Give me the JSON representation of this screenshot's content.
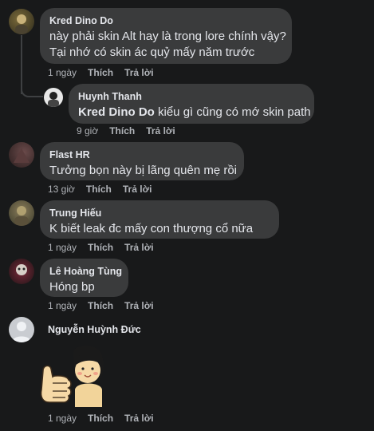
{
  "comments": [
    {
      "author": "Kred Dino Do",
      "lines": [
        "này phải skin Alt hay là trong lore chính vậy?",
        "Tại nhớ có skin ác quỷ mấy năm trước"
      ],
      "time": "1 ngày",
      "like": "Thích",
      "reply": "Trả lời"
    },
    {
      "author": "Huynh Thanh",
      "tag": "Kred Dino Do",
      "text": " kiểu gì cũng có mớ skin path",
      "time": "9 giờ",
      "like": "Thích",
      "reply": "Trả lời"
    },
    {
      "author": "Flast HR",
      "text": "Tưởng bọn này bị lãng quên mẹ rồi",
      "time": "13 giờ",
      "like": "Thích",
      "reply": "Trả lời"
    },
    {
      "author": "Trung Hiếu",
      "text": "K biết leak đc mấy con thượng cổ nữa",
      "time": "1 ngày",
      "like": "Thích",
      "reply": "Trả lời"
    },
    {
      "author": "Lê Hoàng Tùng",
      "text": "Hóng bp",
      "time": "1 ngày",
      "like": "Thích",
      "reply": "Trả lời"
    },
    {
      "author": "Nguyễn Huỳnh Đức",
      "sticker": "thumbs-up-sticker",
      "time": "1 ngày",
      "like": "Thích",
      "reply": "Trả lời"
    }
  ],
  "colors": {
    "background": "#18191a",
    "bubble": "#3a3b3c",
    "text": "#e4e6eb",
    "meta": "#b0b3b8"
  }
}
